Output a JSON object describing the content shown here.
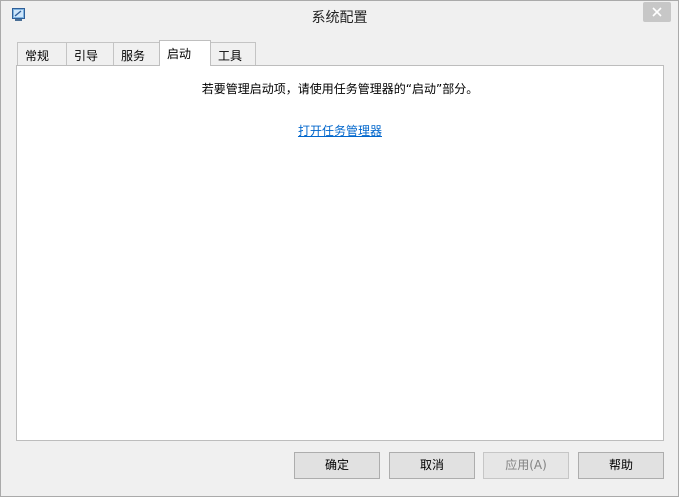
{
  "window": {
    "title": "系统配置",
    "icon": "msconfig-icon"
  },
  "tabs": [
    {
      "label": "常规",
      "selected": false
    },
    {
      "label": "引导",
      "selected": false
    },
    {
      "label": "服务",
      "selected": false
    },
    {
      "label": "启动",
      "selected": true
    },
    {
      "label": "工具",
      "selected": false
    }
  ],
  "startup_panel": {
    "message": "若要管理启动项，请使用任务管理器的“启动”部分。",
    "link_text": "打开任务管理器"
  },
  "buttons": {
    "ok": "确定",
    "cancel": "取消",
    "apply": "应用(A)",
    "help": "帮助"
  },
  "colors": {
    "link": "#0066cc",
    "window_bg": "#f0f0f0",
    "close_button_bg": "#c7c7c7"
  }
}
